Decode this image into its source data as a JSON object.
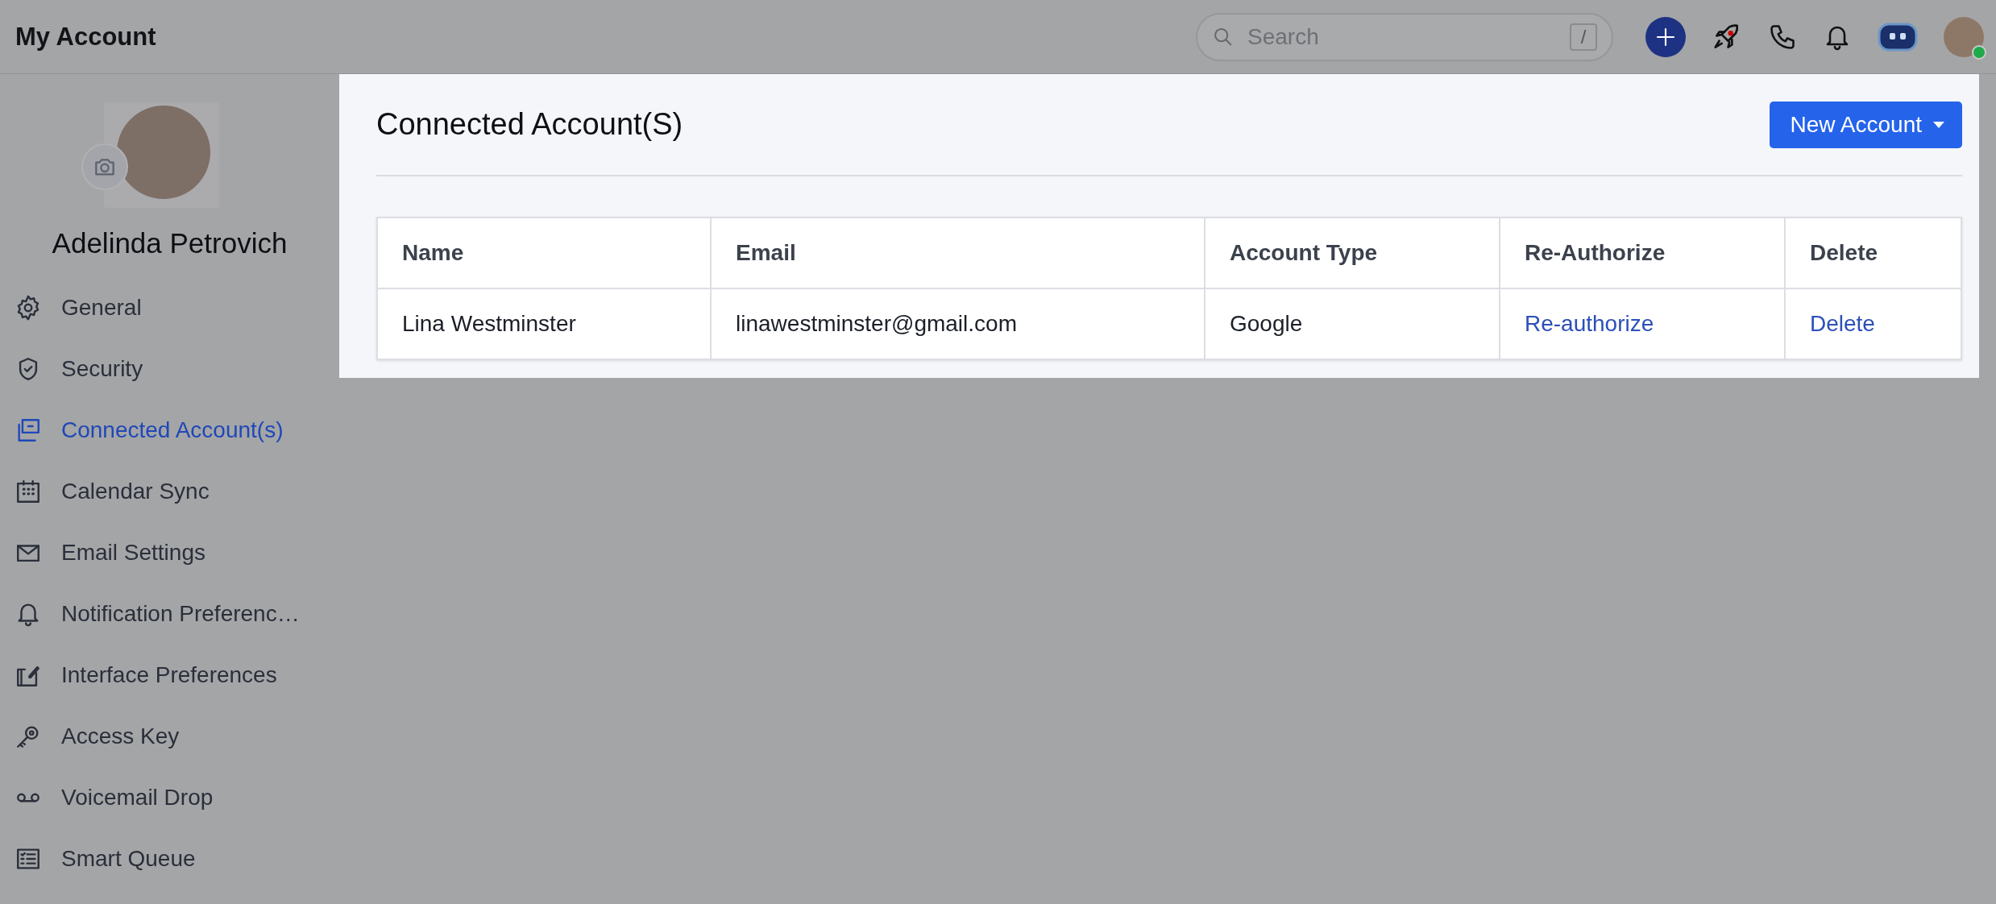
{
  "header": {
    "title": "My Account",
    "search": {
      "placeholder": "Search",
      "shortcut": "/"
    },
    "user_online": true
  },
  "profile": {
    "name": "Adelinda Petrovich"
  },
  "sidebar": {
    "items": [
      {
        "label": "General",
        "selected": false
      },
      {
        "label": "Security",
        "selected": false
      },
      {
        "label": "Connected Account(s)",
        "selected": true
      },
      {
        "label": "Calendar Sync",
        "selected": false
      },
      {
        "label": "Email Settings",
        "selected": false
      },
      {
        "label": "Notification Preferenc…",
        "selected": false
      },
      {
        "label": "Interface Preferences",
        "selected": false
      },
      {
        "label": "Access Key",
        "selected": false
      },
      {
        "label": "Voicemail Drop",
        "selected": false
      },
      {
        "label": "Smart Queue",
        "selected": false
      }
    ]
  },
  "panel": {
    "title": "Connected Account(S)",
    "new_button": "New Account",
    "table": {
      "columns": [
        "Name",
        "Email",
        "Account Type",
        "Re-Authorize",
        "Delete"
      ],
      "rows": [
        {
          "name": "Lina Westminster",
          "email": "linawestminster@gmail.com",
          "account_type": "Google",
          "reauthorize": "Re-authorize",
          "delete": "Delete"
        }
      ]
    }
  }
}
